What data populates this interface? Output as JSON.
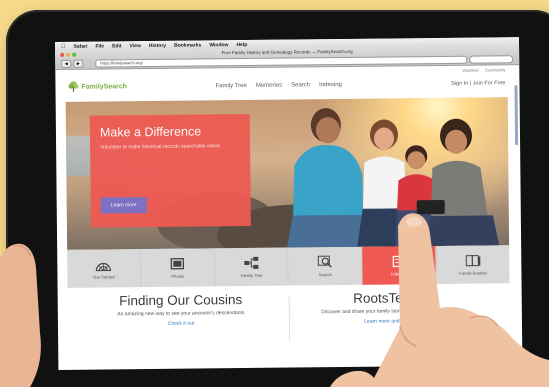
{
  "mac_menu": [
    "Safari",
    "File",
    "Edit",
    "View",
    "History",
    "Bookmarks",
    "Window",
    "Help"
  ],
  "browser": {
    "window_title": "Free Family History and Genealogy Records — FamilySearch.org",
    "url": "https://familysearch.org/"
  },
  "site": {
    "logo_text": "FamilySearch",
    "util_links": [
      "Volunteer",
      "Community"
    ],
    "nav": [
      "Family Tree",
      "Memories",
      "Search",
      "Indexing"
    ],
    "signin": "Sign In | Join For Free"
  },
  "hero": {
    "title": "Make a Difference",
    "subtitle": "Volunteer to make historical records searchable online.",
    "button": "Learn more"
  },
  "iconbar": [
    {
      "label": "Get Started",
      "icon": "fan-chart-icon",
      "active": false
    },
    {
      "label": "Photos",
      "icon": "photos-icon",
      "active": false
    },
    {
      "label": "Family Tree",
      "icon": "family-tree-icon",
      "active": false
    },
    {
      "label": "Search",
      "icon": "search-icon",
      "active": false
    },
    {
      "label": "Indexing",
      "icon": "indexing-icon",
      "active": true
    },
    {
      "label": "Family Booklet",
      "icon": "booklet-icon",
      "active": false
    }
  ],
  "features": [
    {
      "title": "Finding Our Cousins",
      "text": "An amazing new way to see your ancestor's descendants",
      "link": "Check it out"
    },
    {
      "title": "RootsTech 2",
      "text": "Discover and share your family stories and present, and future.",
      "link": "Learn more and register"
    }
  ],
  "colors": {
    "accent": "#ef5a52",
    "button": "#7a70c8",
    "logo": "#7ab244",
    "link": "#3b79c3"
  }
}
